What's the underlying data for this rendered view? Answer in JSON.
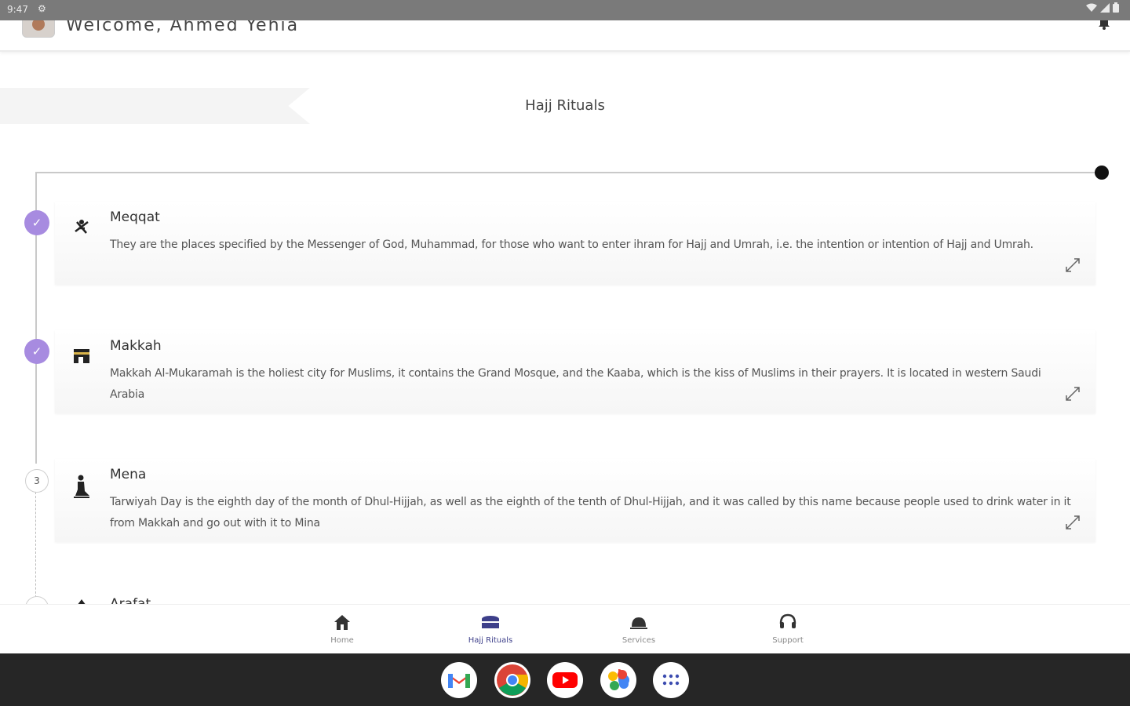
{
  "status_bar": {
    "time": "9:47"
  },
  "header": {
    "welcome": "Welcome, Ahmed Yehia"
  },
  "page": {
    "title": "Hajj Rituals"
  },
  "rituals": [
    {
      "title": "Meqqat",
      "description": "They are the places specified by the Messenger of God, Muhammad, for those who want to enter ihram for Hajj and Umrah, i.e. the intention or intention of Hajj and Umrah.",
      "status": "done",
      "icon": "ihram-icon"
    },
    {
      "title": "Makkah",
      "description": "Makkah Al-Mukaramah is the holiest city for Muslims, it contains the Grand Mosque, and the Kaaba, which is the kiss of Muslims in their prayers. It is located in western Saudi Arabia",
      "status": "done",
      "icon": "kaaba-icon"
    },
    {
      "title": "Mena",
      "step_number": "3",
      "description": "Tarwiyah Day is the eighth day of the month of Dhul-Hijjah, as well as the eighth of the tenth of Dhul-Hijjah, and it was called by this name because people used to drink water in it from Makkah and go out with it to Mina",
      "status": "pending",
      "icon": "prayer-icon"
    },
    {
      "title": "Arafat",
      "status": "pending",
      "icon": "mountain-icon"
    }
  ],
  "bottom_nav": {
    "items": [
      {
        "label": "Home",
        "icon": "home-icon",
        "active": false
      },
      {
        "label": "Hajj Rituals",
        "icon": "kaaba-icon",
        "active": true
      },
      {
        "label": "Services",
        "icon": "services-icon",
        "active": false
      },
      {
        "label": "Support",
        "icon": "headset-icon",
        "active": false
      }
    ]
  },
  "dock": {
    "apps": [
      "Gmail",
      "Chrome",
      "YouTube",
      "Photos",
      "App drawer"
    ]
  },
  "colors": {
    "accent_done": "#a78be0",
    "nav_active": "#3d3f8a",
    "taskbar": "#262626",
    "statusbar": "#7a7a7a"
  }
}
